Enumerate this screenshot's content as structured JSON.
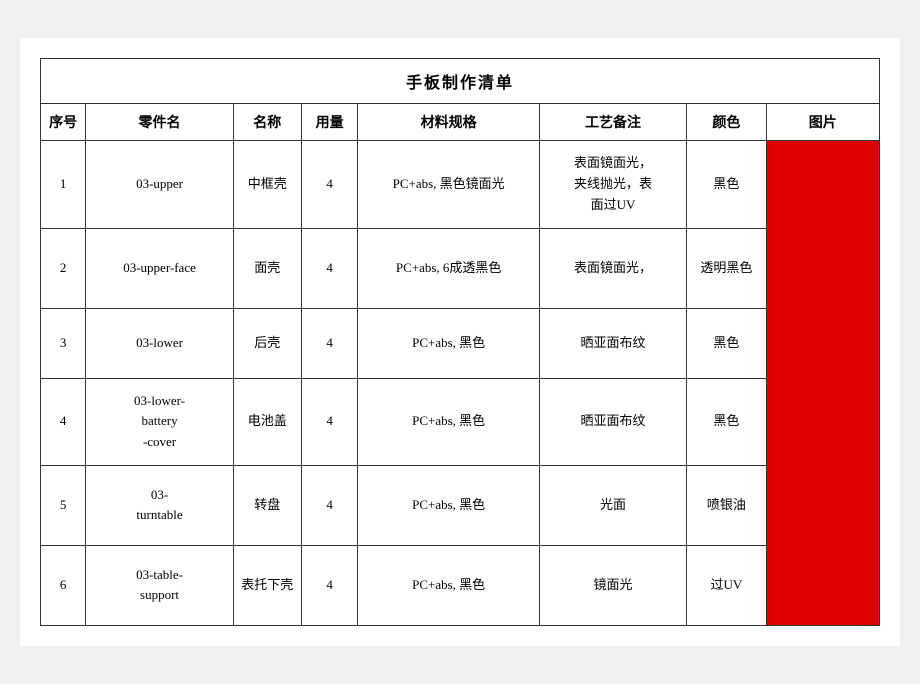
{
  "table": {
    "title": "手板制作清单",
    "headers": {
      "seq": "序号",
      "partname": "零件名",
      "name": "名称",
      "qty": "用量",
      "material": "材料规格",
      "process": "工艺备注",
      "color": "颜色",
      "image": "图片"
    },
    "rows": [
      {
        "seq": "1",
        "partname": "03-upper",
        "name": "中框壳",
        "qty": "4",
        "material": "PC+abs, 黑色镜面光",
        "process": "表面镜面光，夹线抛光，表面过UV",
        "color": "黑色"
      },
      {
        "seq": "2",
        "partname": "03-upper-face",
        "name": "面壳",
        "qty": "4",
        "material": "PC+abs, 6成透黑色",
        "process": "表面镜面光，",
        "color": "透明黑色"
      },
      {
        "seq": "3",
        "partname": "03-lower",
        "name": "后壳",
        "qty": "4",
        "material": "PC+abs, 黑色",
        "process": "晒亚面布纹",
        "color": "黑色"
      },
      {
        "seq": "4",
        "partname": "03-lower-battery-cover",
        "name": "电池盖",
        "qty": "4",
        "material": "PC+abs, 黑色",
        "process": "晒亚面布纹",
        "color": "黑色"
      },
      {
        "seq": "5",
        "partname": "03-turntable",
        "name": "转盘",
        "qty": "4",
        "material": "PC+abs, 黑色",
        "process": "光面",
        "color": "喷银油"
      },
      {
        "seq": "6",
        "partname": "03-table-support",
        "name": "表托下壳",
        "qty": "4",
        "material": "PC+abs, 黑色",
        "process": "镜面光",
        "color": "过UV"
      }
    ]
  }
}
